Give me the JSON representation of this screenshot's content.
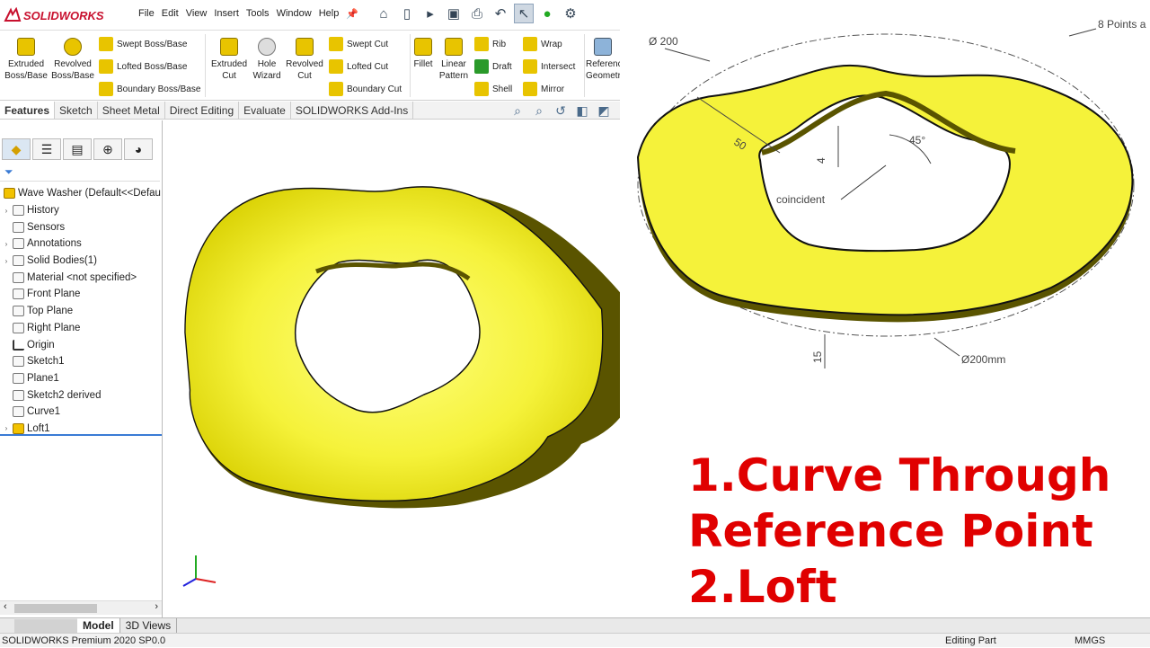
{
  "app": {
    "logo_text": "SOLIDWORKS"
  },
  "menu": [
    "File",
    "Edit",
    "View",
    "Insert",
    "Tools",
    "Window",
    "Help"
  ],
  "ribbon": {
    "extruded_boss": "Extruded Boss/Base",
    "revolved_boss": "Revolved Boss/Base",
    "swept_boss": "Swept Boss/Base",
    "lofted_boss": "Lofted Boss/Base",
    "boundary_boss": "Boundary Boss/Base",
    "extruded_cut": "Extruded Cut",
    "hole_wizard": "Hole Wizard",
    "revolved_cut": "Revolved Cut",
    "swept_cut": "Swept Cut",
    "lofted_cut": "Lofted Cut",
    "boundary_cut": "Boundary Cut",
    "fillet": "Fillet",
    "linear_pattern": "Linear Pattern",
    "rib": "Rib",
    "wrap": "Wrap",
    "draft": "Draft",
    "intersect": "Intersect",
    "shell": "Shell",
    "mirror": "Mirror",
    "reference_geometry": "Reference Geometry"
  },
  "tabs": [
    "Features",
    "Sketch",
    "Sheet Metal",
    "Direct Editing",
    "Evaluate",
    "SOLIDWORKS Add-Ins"
  ],
  "tree": {
    "root": "Wave Washer  (Default<<Defau",
    "items": [
      "History",
      "Sensors",
      "Annotations",
      "Solid Bodies(1)",
      "Material <not specified>",
      "Front Plane",
      "Top Plane",
      "Right Plane",
      "Origin",
      "Sketch1",
      "Plane1",
      "Sketch2 derived",
      "Curve1",
      "Loft1"
    ]
  },
  "bottom_tabs": [
    "Model",
    "3D Views"
  ],
  "status": {
    "version": "SOLIDWORKS Premium 2020 SP0.0",
    "mode": "Editing Part",
    "units": "MMGS"
  },
  "drawing": {
    "dia_top": "Ø 200",
    "points_label": "8 Points a",
    "dim_50": "50",
    "dim_4": "4",
    "angle": "45°",
    "coincident": "coincident",
    "dim_15": "15",
    "dia_bottom": "Ø200mm"
  },
  "overlay": {
    "line1": "1.Curve Through",
    "line2": "Reference Point",
    "line3": "2.Loft"
  },
  "colors": {
    "part_yellow": "#f5f23a",
    "part_edge": "#1a1a00",
    "overlay_red": "#e00000",
    "brand_red": "#c8102e"
  }
}
